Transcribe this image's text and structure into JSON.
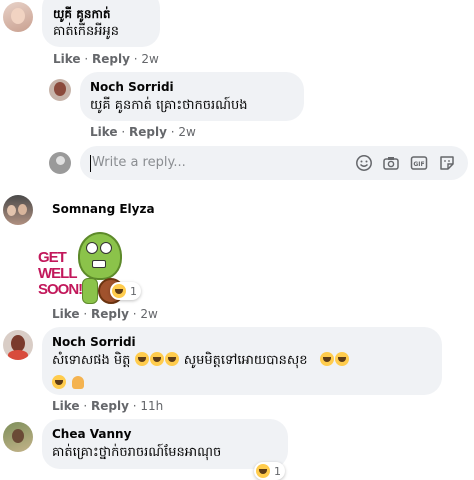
{
  "comments": [
    {
      "name": "យូគី គូនកាត់",
      "text": "គាត់កើនអីអូន",
      "like": "Like",
      "reply": "Reply",
      "time": "2w"
    },
    {
      "name": "Noch Sorridi",
      "text": "យូគី គូនកាត់ គ្រោះថាកចរណ៍បង",
      "like": "Like",
      "reply": "Reply",
      "time": "2w"
    },
    {
      "name": "Somnang Elyza",
      "sticker_text": "GET WELL SOON!",
      "reaction_count": "1",
      "like": "Like",
      "reply": "Reply",
      "time": "2w"
    },
    {
      "name": "Noch Sorridi",
      "text": "សំទោសផង មិត្ត",
      "text2": "សូមមិត្តទៅអោយបានសុខ",
      "like": "Like",
      "reply": "Reply",
      "time": "11h"
    },
    {
      "name": "Chea Vanny",
      "text": "គាត់គ្រោះថ្នាក់ចរាចរណ៍មែនអាណុច",
      "reaction_count": "1"
    }
  ],
  "reply_box": {
    "placeholder": "Write a reply..."
  },
  "icons": [
    "emoji-icon",
    "camera-icon",
    "gif-icon",
    "sticker-icon"
  ],
  "colors": {
    "bubble": "#f0f2f5",
    "meta": "#65676b",
    "sticker_pink": "#c2185b",
    "turtle_green": "#8bc34a"
  }
}
